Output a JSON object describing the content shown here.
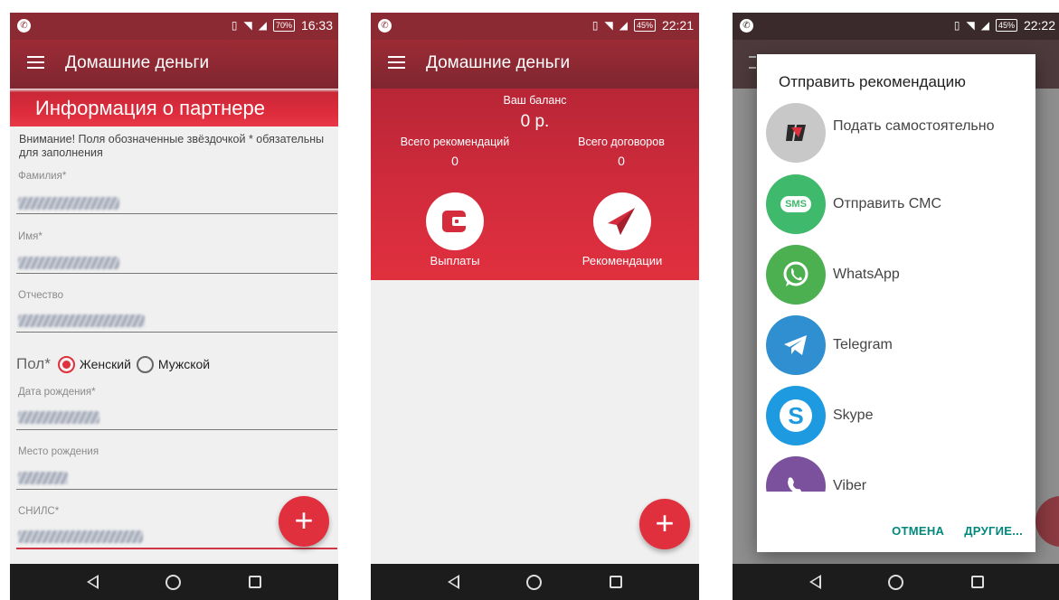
{
  "screen1": {
    "status": {
      "battery": "70%",
      "time": "16:33"
    },
    "app_title": "Домашние деньги",
    "section_title": "Информация о партнере",
    "notice": "Внимание! Поля обозначенные звёздочкой * обязательны для заполнения",
    "fields": {
      "last_name": "Фамилия*",
      "first_name": "Имя*",
      "patronymic": "Отчество",
      "birth_date": "Дата рождения*",
      "birth_place": "Место рождения",
      "snils": "СНИЛС*"
    },
    "gender": {
      "label": "Пол*",
      "female": "Женский",
      "male": "Мужской",
      "selected": "female"
    },
    "fab": "+"
  },
  "screen2": {
    "status": {
      "battery": "45%",
      "time": "22:21"
    },
    "app_title": "Домашние деньги",
    "balance_label": "Ваш баланс",
    "balance_value": "0 р.",
    "recommendations_label": "Всего рекомендаций",
    "recommendations_value": "0",
    "contracts_label": "Всего договоров",
    "contracts_value": "0",
    "payouts_label": "Выплаты",
    "recommend_label": "Рекомендации",
    "fab": "+"
  },
  "screen3": {
    "status": {
      "battery": "45%",
      "time": "22:22"
    },
    "dialog_title": "Отправить рекомендацию",
    "items": [
      {
        "label": "Подать самостоятельно",
        "icon": "app-logo-icon",
        "color": "#c8c8c8"
      },
      {
        "label": "Отправить СМС",
        "icon": "sms-icon",
        "icon_text": "SMS",
        "color": "#3fb96b"
      },
      {
        "label": "WhatsApp",
        "icon": "whatsapp-icon",
        "color": "#4caf50"
      },
      {
        "label": "Telegram",
        "icon": "telegram-icon",
        "color": "#2f8fd0"
      },
      {
        "label": "Skype",
        "icon": "skype-icon",
        "color": "#1e9be0"
      },
      {
        "label": "Viber",
        "icon": "viber-icon",
        "color": "#7b519d"
      }
    ],
    "cancel_label": "ОТМЕНА",
    "more_label": "ДРУГИЕ..."
  },
  "colors": {
    "primary_dark": "#8b2a33",
    "accent_red": "#e0303e",
    "dialog_action": "#00897b"
  }
}
